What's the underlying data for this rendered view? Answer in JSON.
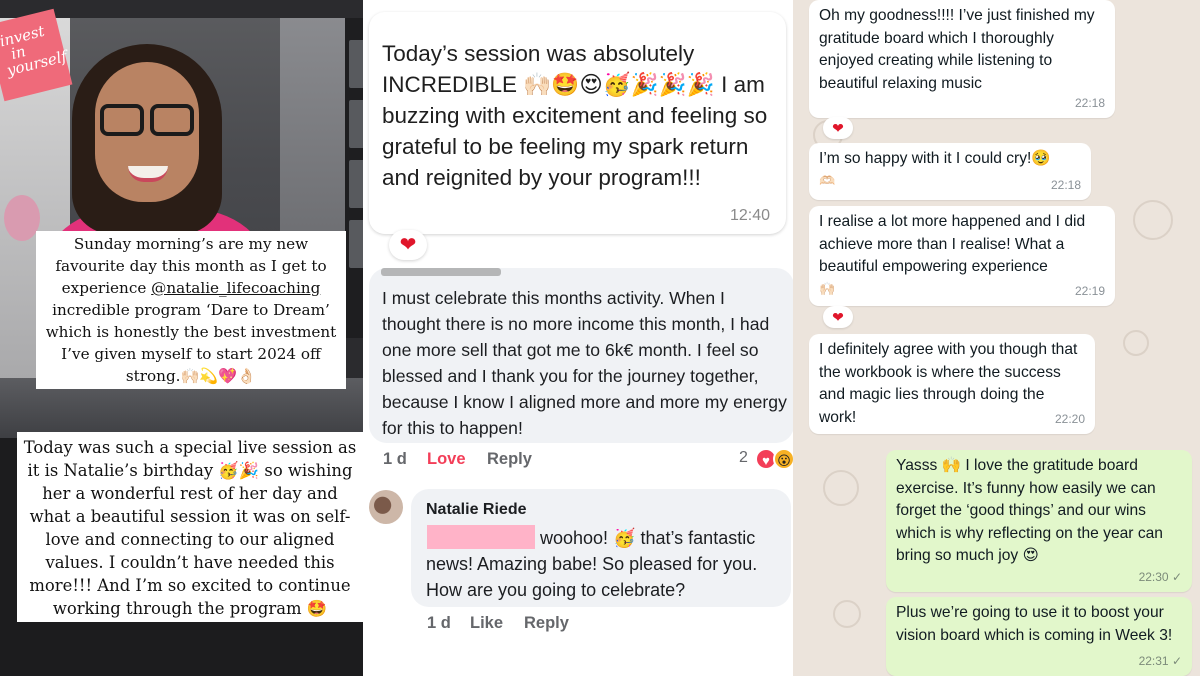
{
  "left": {
    "sign": [
      "invest",
      "in",
      "yourself"
    ],
    "caption1": {
      "pre": "Sunday morning’s are my new favourite day this month as I get to experience ",
      "mention": "@natalie_lifecoaching",
      "post": " incredible program ‘Dare to Dream’ which is honestly the best investment I’ve given myself to start 2024 off strong.🙌🏻💫💖👌🏻"
    },
    "caption2": "Today was such a special live session as it is Natalie’s birthday 🥳🎉 so wishing her a wonderful rest of her day and what a beautiful session it was on self-love and connecting to our aligned values. I couldn’t have needed this more!!! And I’m so excited to continue working through the program 🤩"
  },
  "middle": {
    "message": {
      "text": "Today’s session was absolutely INCREDIBLE 🙌🏻🤩😍🥳🎉🎉🎉 I am buzzing with excitement and feeling so grateful to be feeling my spark return and reignited by your program!!!",
      "time": "12:40",
      "reaction": "❤"
    },
    "comment": {
      "text": "I must celebrate this months activity. When I thought there is no more income this month, I had one more sell that got me to 6k€ month. I feel so blessed and I thank you for the journey together, because I know I aligned more and more my energy for this to happen!",
      "age": "1 d",
      "love_label": "Love",
      "reply_label": "Reply",
      "reaction_count": "2",
      "love_icon": "♥",
      "wow_icon": "😮"
    },
    "reply": {
      "author": "Natalie Riede",
      "text": "woohoo! 🥳 that’s fantastic news! Amazing babe! So pleased for you. How are you going to celebrate?",
      "age": "1 d",
      "like_label": "Like",
      "reply_label": "Reply"
    }
  },
  "whatsapp": {
    "messages": [
      {
        "text": "Oh my goodness!!!! I’ve just finished my gratitude board which I thoroughly enjoyed creating while listening to beautiful relaxing music",
        "time": "22:18",
        "reaction": "❤"
      },
      {
        "text": "I’m so happy with it I could cry!🥹",
        "extra": "🫶🏻",
        "time": "22:18"
      },
      {
        "text": "I realise a lot more happened and I did achieve more than I realise! What a beautiful empowering experience",
        "extra": "🙌🏻",
        "time": "22:19",
        "reaction": "❤"
      },
      {
        "text": "I definitely agree with you though that the workbook is where the success and magic lies through doing the work!",
        "time": "22:20"
      },
      {
        "text": "Yasss 🙌 I love the gratitude board exercise. It’s funny how easily we can forget the ‘good things’ and our wins which is why reflecting on the year can bring so much joy 😍",
        "time": "22:30 ✓"
      },
      {
        "text": "Plus we’re going to use it to boost your vision board which is coming in Week 3!",
        "time": "22:31 ✓"
      }
    ]
  },
  "colors": {
    "fb_love": "#f33e58",
    "wa_outgoing": "#e2f7cb",
    "wa_background": "#ece4dc",
    "caption_bg": "#ffffff",
    "shirt_pink": "#e2317a"
  }
}
